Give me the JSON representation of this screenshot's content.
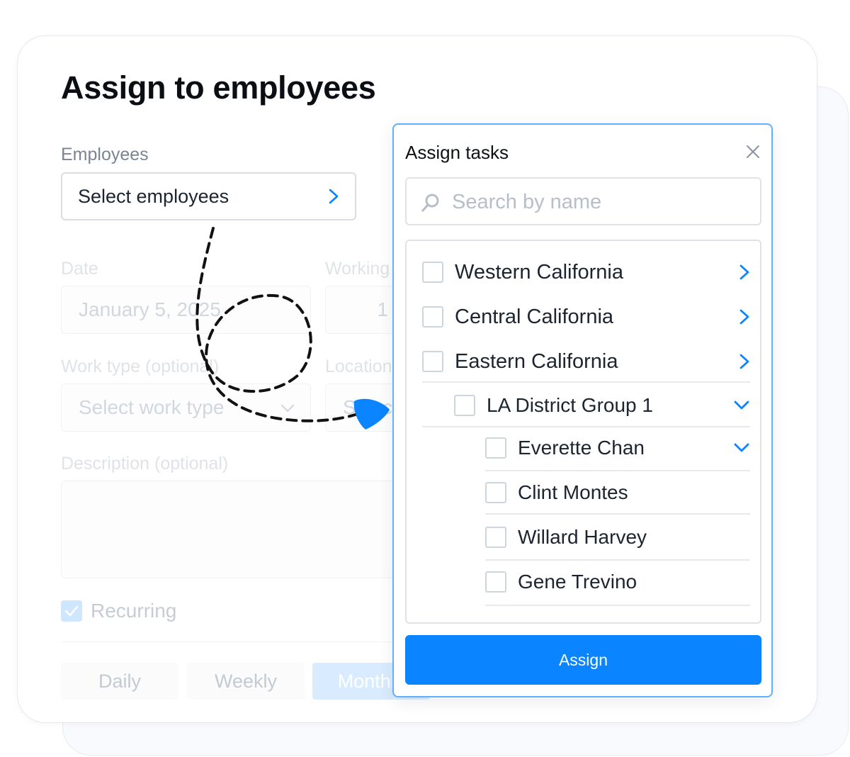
{
  "page": {
    "title": "Assign to employees"
  },
  "form": {
    "employees_label": "Employees",
    "employees_value": "Select employees",
    "date_label": "Date",
    "date_value": "January 5, 2025",
    "working_label": "Working",
    "working_value": "1",
    "work_type_label": "Work type (optional)",
    "work_type_value": "Select work type",
    "location_label": "Location",
    "location_value": "Select",
    "description_label": "Description (optional)",
    "recurring_label": "Recurring",
    "frequency": [
      "Daily",
      "Weekly",
      "Monthly"
    ]
  },
  "dialog": {
    "title": "Assign tasks",
    "search_placeholder": "Search by name",
    "regions": [
      "Western California",
      "Central California",
      "Eastern California"
    ],
    "group": "LA District Group 1",
    "employees": [
      "Everette Chan",
      "Clint Montes",
      "Willard Harvey",
      "Gene Trevino"
    ],
    "assign_label": "Assign"
  },
  "colors": {
    "accent": "#0a84ff",
    "dialog_border": "#5fb0ff",
    "text": "#1c2430",
    "muted": "#7a8593"
  },
  "icons": [
    "chevron-right-icon",
    "chevron-down-icon",
    "close-icon",
    "search-icon",
    "checkmark-icon",
    "arrow-head-icon"
  ]
}
